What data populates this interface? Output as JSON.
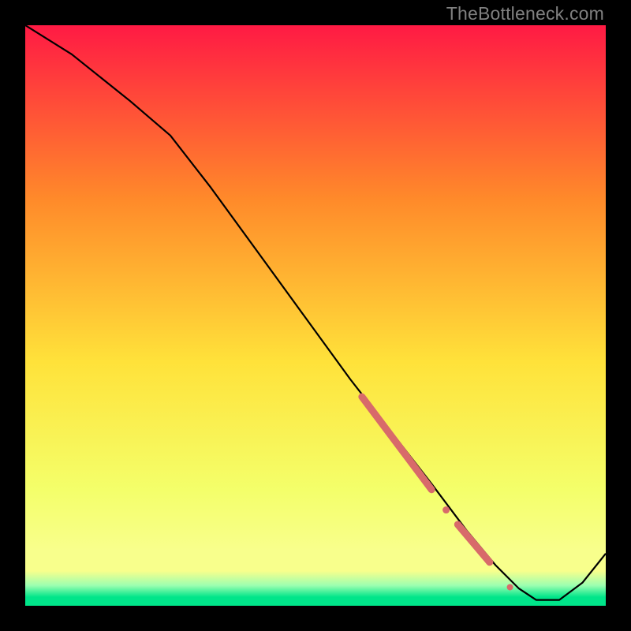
{
  "watermark": "TheBottleneck.com",
  "colors": {
    "top": "#ff1a44",
    "mid_upper": "#ff8a2a",
    "mid": "#ffe23a",
    "mid_lower": "#f4ff6a",
    "band_yellow": "#f8ff8c",
    "band_green_light": "#9cffb0",
    "band_green": "#00e58a",
    "line": "#000000",
    "marker": "#d86a6a",
    "outer": "#000000"
  },
  "chart_data": {
    "type": "line",
    "title": "",
    "xlabel": "",
    "ylabel": "",
    "xlim": [
      0,
      100
    ],
    "ylim": [
      0,
      100
    ],
    "series": [
      {
        "name": "curve",
        "x": [
          0,
          8,
          18,
          25,
          32,
          40,
          48,
          56,
          63,
          70,
          76,
          81,
          85,
          88,
          92,
          96,
          100
        ],
        "values": [
          100,
          95,
          87,
          81,
          72,
          61,
          50,
          39,
          30,
          21,
          13,
          7,
          3,
          1,
          1,
          4,
          9
        ]
      }
    ],
    "markers": [
      {
        "name": "segment-a",
        "type": "segment",
        "x0": 58,
        "y0": 36,
        "x1": 70,
        "y1": 20,
        "width": 9
      },
      {
        "name": "dot-a",
        "type": "dot",
        "x": 72.5,
        "y": 16.5,
        "r": 4.5
      },
      {
        "name": "segment-b",
        "type": "segment",
        "x0": 74.5,
        "y0": 14,
        "x1": 80,
        "y1": 7.5,
        "width": 9
      },
      {
        "name": "dot-b",
        "type": "dot",
        "x": 83.5,
        "y": 3.2,
        "r": 4.0
      }
    ]
  }
}
